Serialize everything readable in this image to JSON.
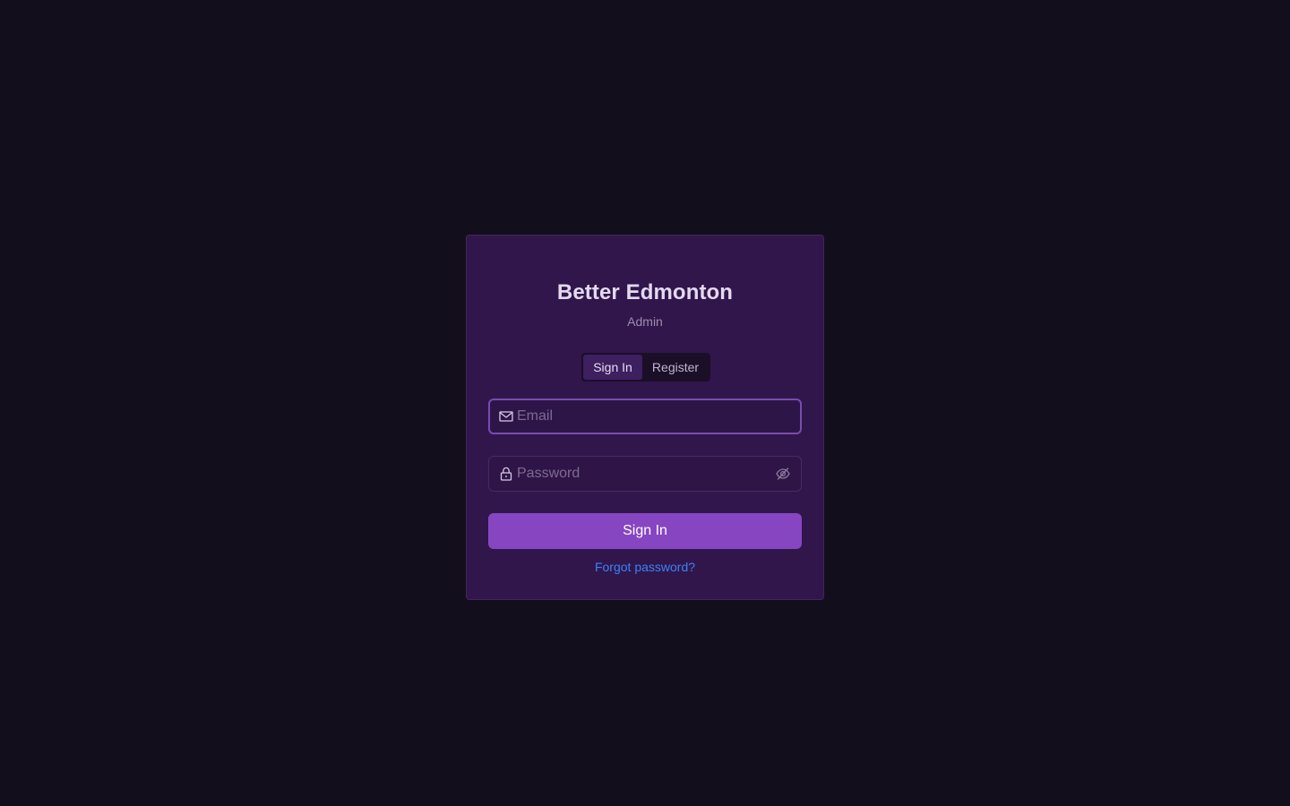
{
  "app": {
    "title": "Better Edmonton",
    "subtitle": "Admin"
  },
  "tabs": [
    {
      "label": "Sign In",
      "active": true
    },
    {
      "label": "Register",
      "active": false
    }
  ],
  "form": {
    "email": {
      "placeholder": "Email",
      "value": "",
      "icon": "mail-icon"
    },
    "password": {
      "placeholder": "Password",
      "value": "",
      "icon": "lock-icon",
      "toggle_icon": "eye-off-icon"
    },
    "submit_label": "Sign In",
    "forgot_label": "Forgot password?"
  },
  "colors": {
    "background": "#130e1b",
    "card": "#31164c",
    "accent": "#8646c2",
    "link": "#3b82f6"
  }
}
